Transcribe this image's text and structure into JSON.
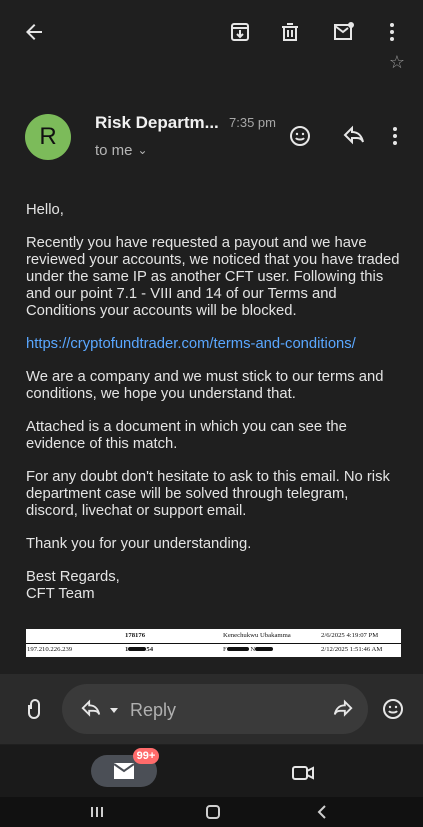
{
  "sender": {
    "avatar_letter": "R",
    "name": "Risk Departm...",
    "time": "7:35 pm",
    "to": "to me"
  },
  "message": {
    "greeting": "Hello,",
    "p1": "Recently you have requested a payout and we have reviewed your accounts, we noticed that you have traded under the same IP as another CFT user. Following this and our point 7.1 - VIII and 14 of our Terms and Conditions your accounts will be blocked.",
    "link": "https://cryptofundtrader.com/terms-and-conditions/",
    "p2": "We are a company and we must stick to our terms and conditions, we hope you understand that.",
    "p3": "Attached is a document in which you can see the evidence of this match.",
    "p4": "For any doubt don't hesitate to ask to this email. No risk department case will be solved through telegram, discord, livechat or support email.",
    "p5": "Thank you for your understanding.",
    "closing_1": "Best Regards,",
    "closing_2": "CFT Team"
  },
  "attachment": {
    "row1": {
      "id": "178176",
      "name": "Kenechukwu Ubakamma",
      "date": "2/6/2025 4:19:07 PM"
    },
    "row2": {
      "ip": "197.210.226.239",
      "id_suffix": "54",
      "date": "2/12/2025 1:51:46 AM"
    }
  },
  "compose": {
    "reply_label": "Reply"
  },
  "bottom_nav": {
    "badge": "99+"
  },
  "icons": {
    "back": "arrow-back-icon",
    "archive": "archive-icon",
    "delete": "trash-icon",
    "mail": "mark-unread-icon",
    "more": "more-vert-icon",
    "emoji": "emoji-icon",
    "reply": "reply-icon",
    "attach": "paperclip-icon",
    "forward": "forward-icon",
    "video": "video-icon",
    "mail_nav": "mail-icon"
  },
  "colors": {
    "background": "#1f1f1f",
    "avatar": "#7cbb5a",
    "link": "#5aa7ff",
    "badge": "#ff6b6b"
  }
}
